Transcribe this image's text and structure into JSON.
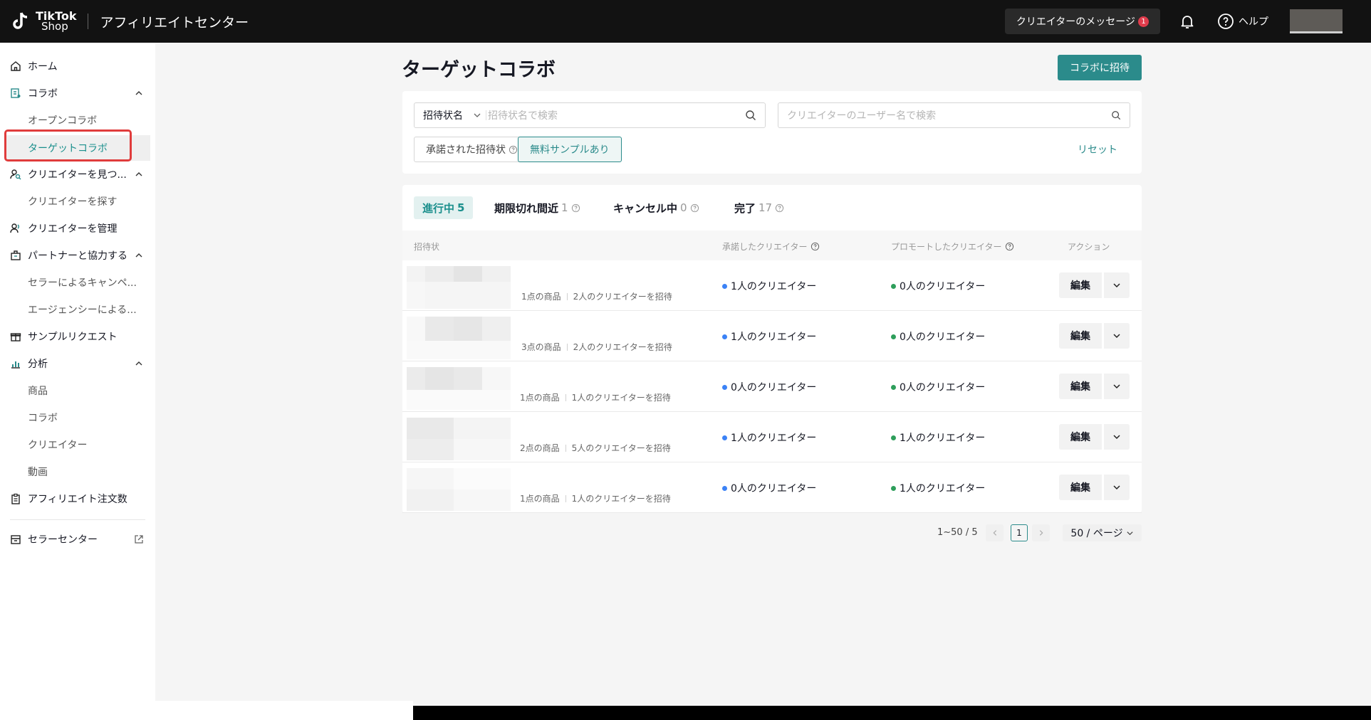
{
  "header": {
    "logo_line1": "TikTok",
    "logo_line2": "Shop",
    "app_title": "アフィリエイトセンター",
    "messages_label": "クリエイターのメッセージ",
    "messages_count": "1",
    "help_label": "ヘルプ"
  },
  "sidebar": {
    "home": "ホーム",
    "collab": "コラボ",
    "open_collab": "オープンコラボ",
    "target_collab": "ターゲットコラボ",
    "find_creators": "クリエイターを見つ...",
    "search_creators": "クリエイターを探す",
    "manage_creators": "クリエイターを管理",
    "partners": "パートナーと協力する",
    "seller_campaigns": "セラーによるキャンペ...",
    "agency": "エージェンシーによる...",
    "sample_requests": "サンプルリクエスト",
    "analytics": "分析",
    "products": "商品",
    "collab_analytics": "コラボ",
    "creators": "クリエイター",
    "videos": "動画",
    "affiliate_orders": "アフィリエイト注文数",
    "seller_center": "セラーセンター"
  },
  "main": {
    "title": "ターゲットコラボ",
    "invite_button": "コラボに招待",
    "filters": {
      "select_label": "招待状名",
      "select_placeholder": "招待状名で検索",
      "creator_placeholder": "クリエイターのユーザー名で検索",
      "chip_accepted": "承諾された招待状",
      "chip_free_sample": "無料サンプルあり",
      "reset": "リセット"
    },
    "tabs": [
      {
        "label": "進行中",
        "count": "5"
      },
      {
        "label": "期限切れ間近",
        "count": "1"
      },
      {
        "label": "キャンセル中",
        "count": "0"
      },
      {
        "label": "完了",
        "count": "17"
      }
    ],
    "columns": {
      "invitation": "招待状",
      "accepted": "承諾したクリエイター",
      "promoted": "プロモートしたクリエイター",
      "action": "アクション"
    },
    "rows": [
      {
        "products": "1点の商品",
        "invited": "2人のクリエイターを招待",
        "accepted": "1人のクリエイター",
        "promoted": "0人のクリエイター",
        "edit": "編集"
      },
      {
        "products": "3点の商品",
        "invited": "2人のクリエイターを招待",
        "accepted": "1人のクリエイター",
        "promoted": "0人のクリエイター",
        "edit": "編集"
      },
      {
        "products": "1点の商品",
        "invited": "1人のクリエイターを招待",
        "accepted": "0人のクリエイター",
        "promoted": "0人のクリエイター",
        "edit": "編集"
      },
      {
        "products": "2点の商品",
        "invited": "5人のクリエイターを招待",
        "accepted": "1人のクリエイター",
        "promoted": "1人のクリエイター",
        "edit": "編集"
      },
      {
        "products": "1点の商品",
        "invited": "1人のクリエイターを招待",
        "accepted": "0人のクリエイター",
        "promoted": "1人のクリエイター",
        "edit": "編集"
      }
    ],
    "pagination": {
      "range": "1~50 / 5",
      "current_page": "1",
      "page_size": "50 / ページ"
    }
  },
  "colors": {
    "accent": "#2b8b8b",
    "accepted_dot": "#3b82f6",
    "promoted_dot": "#2e9e5b",
    "highlight_box": "#e03c3c"
  }
}
